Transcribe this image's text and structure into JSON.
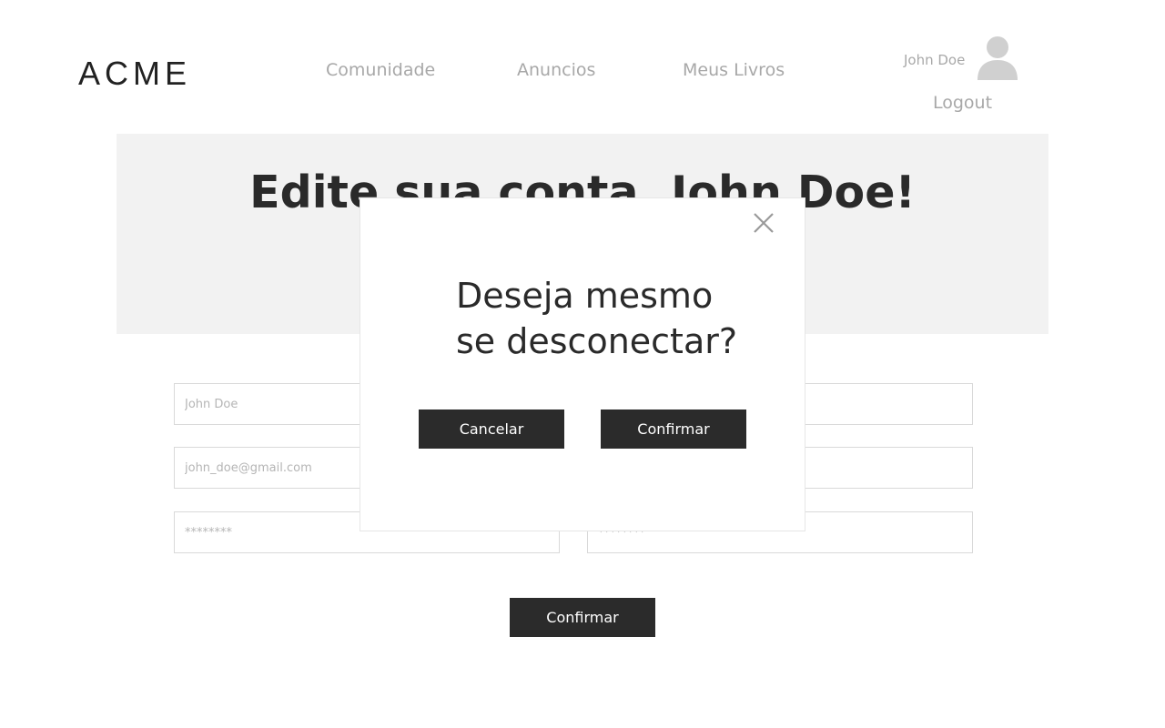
{
  "header": {
    "logo": "ACME",
    "nav": [
      "Comunidade",
      "Anuncios",
      "Meus Livros"
    ],
    "user_name": "John Doe",
    "logout": "Logout"
  },
  "hero": {
    "title": "Edite sua conta, John Doe!"
  },
  "form": {
    "name_placeholder": "John Doe",
    "name_right_placeholder": "",
    "email_placeholder": "john_doe@gmail.com",
    "email_right_placeholder": "",
    "password_placeholder": "********",
    "password_confirm_placeholder": "********",
    "submit_label": "Confirmar"
  },
  "modal": {
    "title_line1": "Deseja mesmo",
    "title_line2": "se desconectar?",
    "cancel_label": "Cancelar",
    "confirm_label": "Confirmar"
  },
  "icons": {
    "avatar": "user-avatar-icon",
    "close": "close-icon"
  },
  "colors": {
    "button_bg": "#2b2b2b",
    "nav_text": "#a8a8a8",
    "hero_bg": "#f2f2f2",
    "avatar": "#d0d0d0"
  }
}
